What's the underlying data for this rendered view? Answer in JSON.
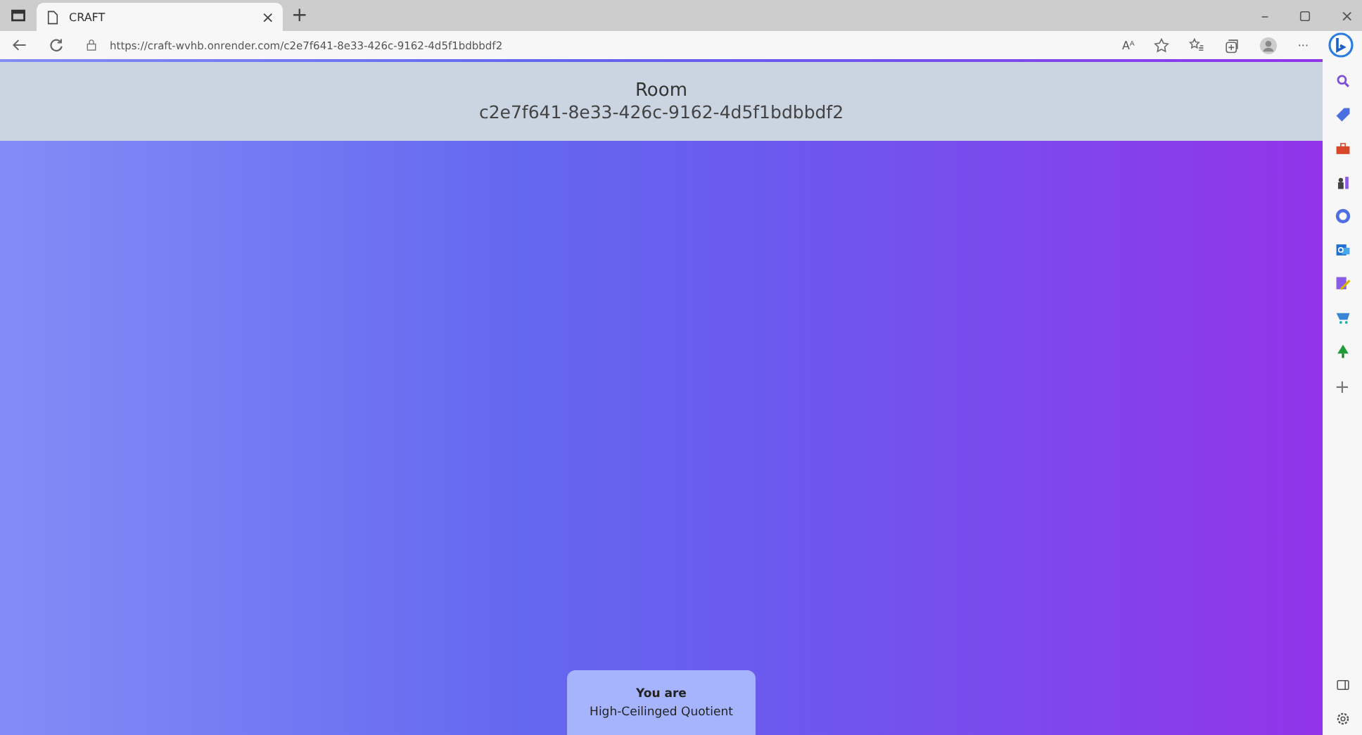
{
  "browser": {
    "tab_title": "CRAFT",
    "tab_close": "×",
    "new_tab": "+",
    "url": "https://craft-wvhb.onrender.com/c2e7f641-8e33-426c-9162-4d5f1bdbbdf2",
    "read_aloud": "Aᴬ",
    "more": "···",
    "window_minimize": "–",
    "window_close": "×",
    "sidebar_add": "+"
  },
  "header": {
    "title": "Room",
    "room_id": "c2e7f641-8e33-426c-9162-4d5f1bdbbdf2"
  },
  "identity_card": {
    "label": "You are",
    "name": "High-Ceilinged Quotient"
  }
}
